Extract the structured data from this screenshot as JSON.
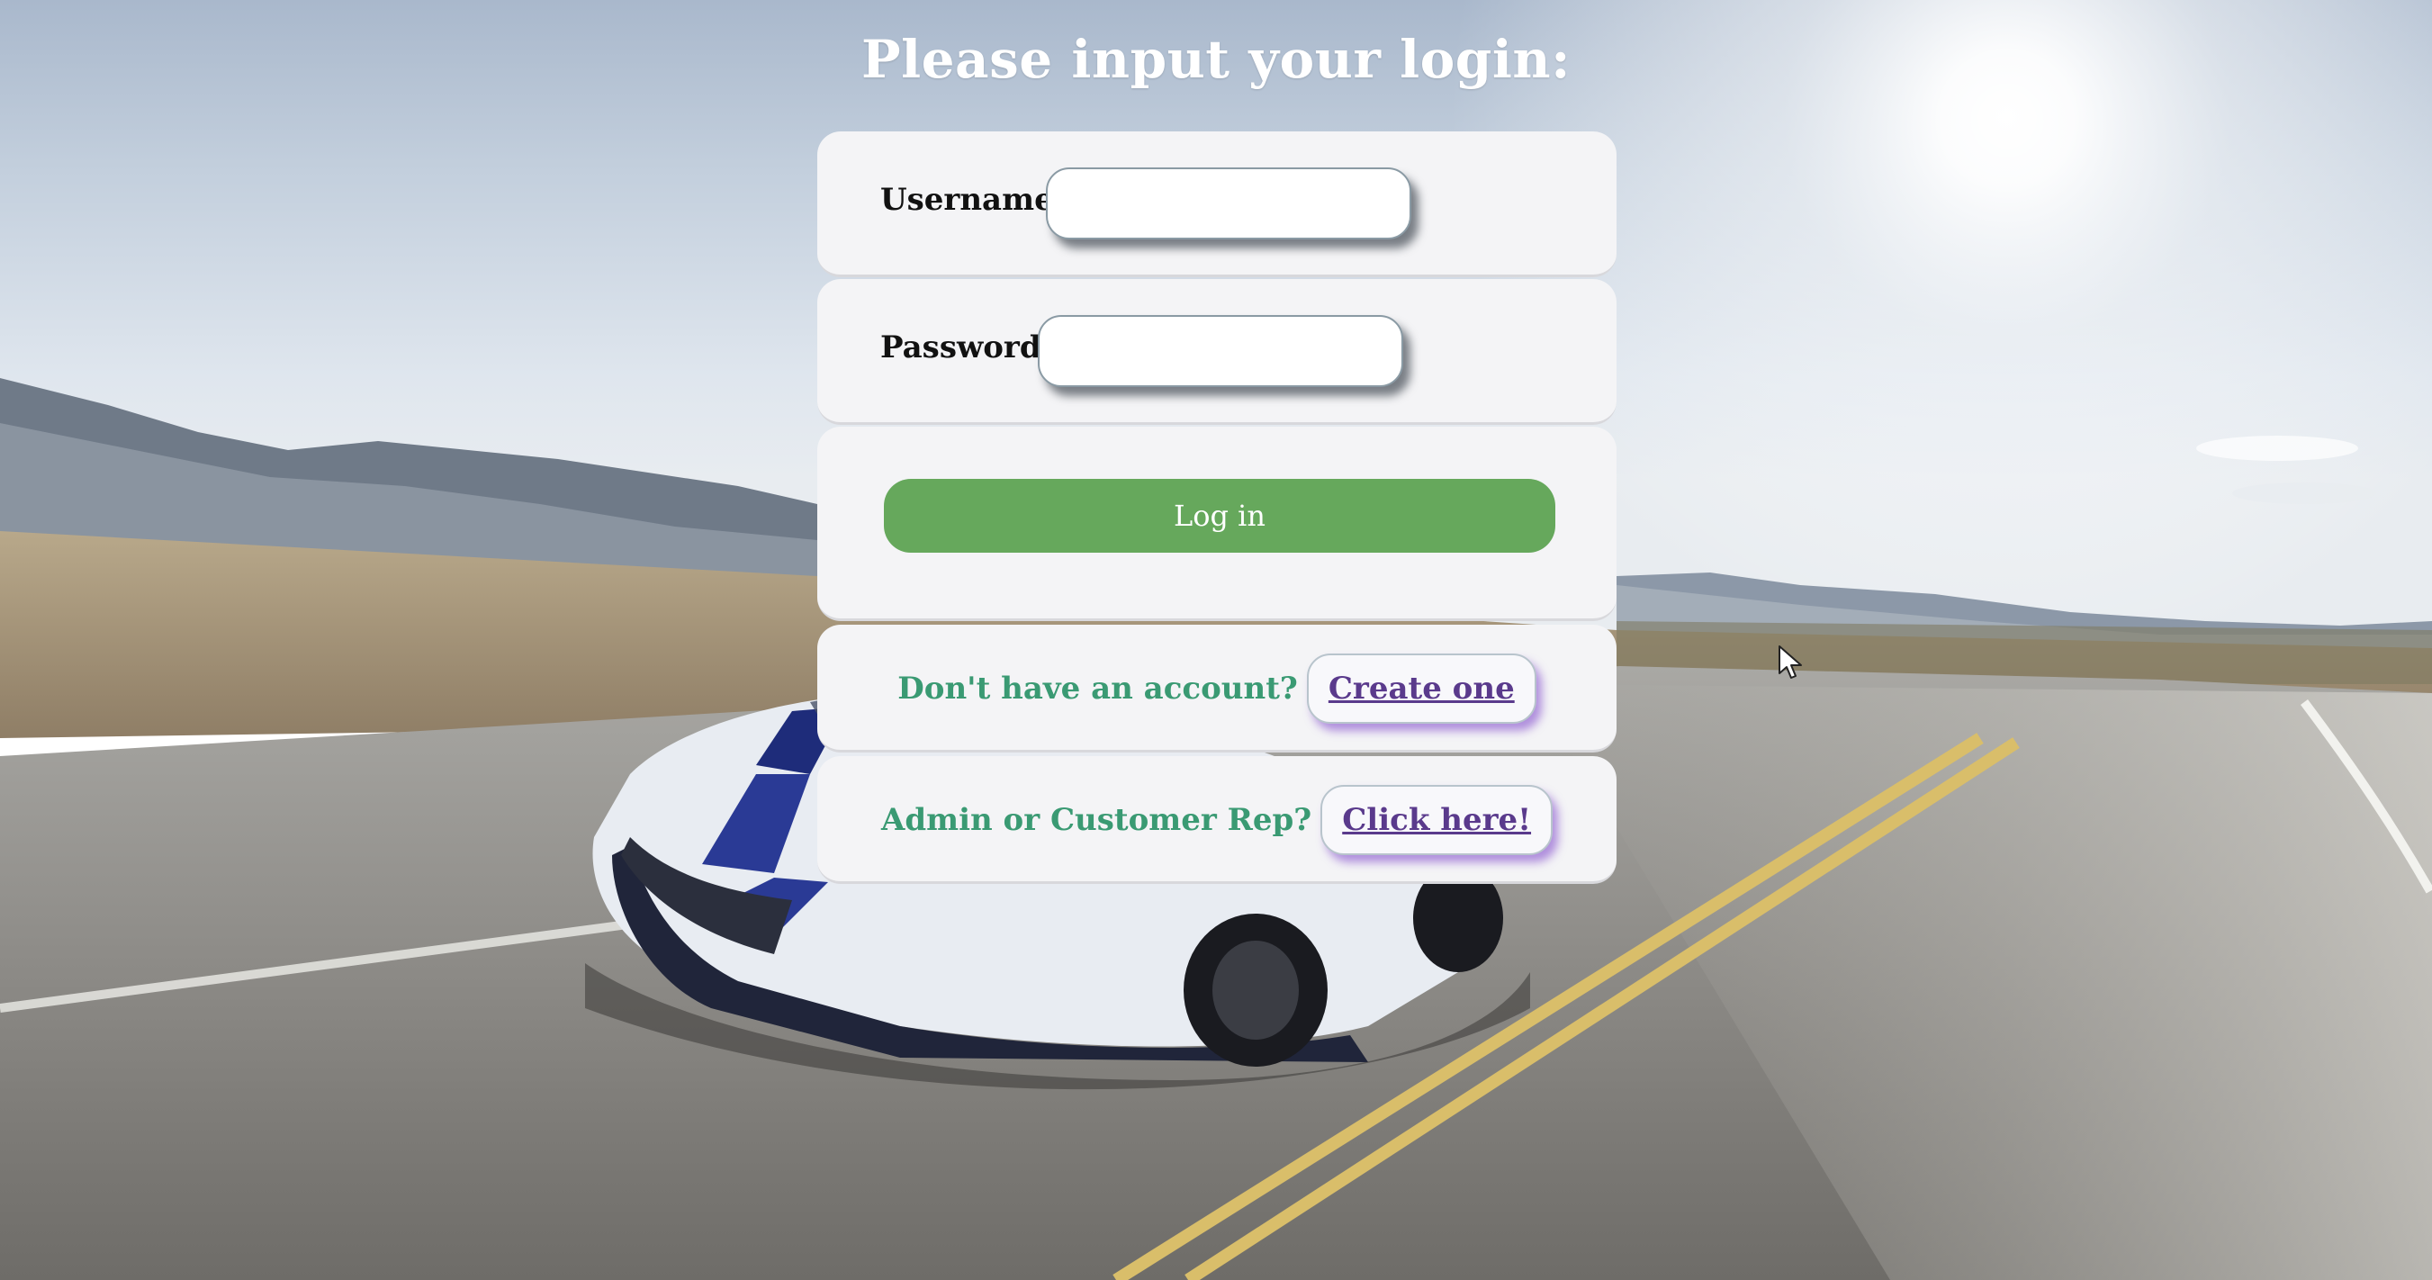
{
  "page": {
    "title": "Please input your login:"
  },
  "form": {
    "username_label": "Username:",
    "username_value": "",
    "password_label": "Password:",
    "password_value": "",
    "login_label": "Log in"
  },
  "signup": {
    "prompt": "Don't have an account?",
    "link_label": "Create one"
  },
  "admin": {
    "prompt": "Admin or Customer Rep?",
    "link_label": "Click here!"
  },
  "colors": {
    "login_button": "#66a85c",
    "prompt_text": "#3a9a73",
    "link_text": "#5a3a8c",
    "panel_bg": "#f4f4f6"
  },
  "icons": {
    "cursor": "mouse-pointer-icon"
  }
}
